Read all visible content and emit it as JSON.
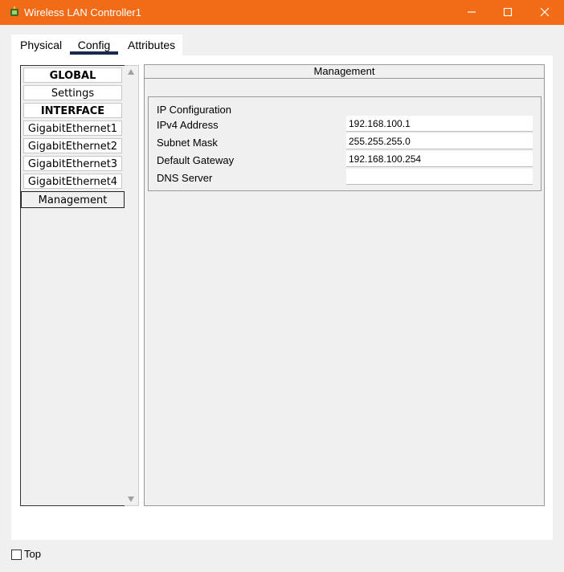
{
  "window": {
    "title": "Wireless LAN Controller1",
    "icon": "cisco-device-icon",
    "controls": [
      "minimize-icon",
      "maximize-icon",
      "close-icon"
    ]
  },
  "tabs": [
    {
      "label": "Physical",
      "active": false
    },
    {
      "label": "Config",
      "active": true
    },
    {
      "label": "Attributes",
      "active": false
    }
  ],
  "sidebar": {
    "items": [
      {
        "label": "GLOBAL",
        "bold": true
      },
      {
        "label": "Settings"
      },
      {
        "label": "INTERFACE",
        "bold": true
      },
      {
        "label": "GigabitEthernet1"
      },
      {
        "label": "GigabitEthernet2"
      },
      {
        "label": "GigabitEthernet3"
      },
      {
        "label": "GigabitEthernet4"
      },
      {
        "label": "Management",
        "selected": true
      }
    ]
  },
  "management": {
    "header": "Management",
    "ip_config": {
      "title": "IP Configuration",
      "fields": [
        {
          "label": "IPv4 Address",
          "value": "192.168.100.1"
        },
        {
          "label": "Subnet Mask",
          "value": "255.255.255.0"
        },
        {
          "label": "Default Gateway",
          "value": "192.168.100.254"
        },
        {
          "label": "DNS Server",
          "value": ""
        }
      ]
    }
  },
  "footer": {
    "top_checkbox_label": "Top",
    "top_checked": false
  },
  "colors": {
    "titlebar": "#f26b16",
    "tab_underline": "#1a2a4f"
  }
}
